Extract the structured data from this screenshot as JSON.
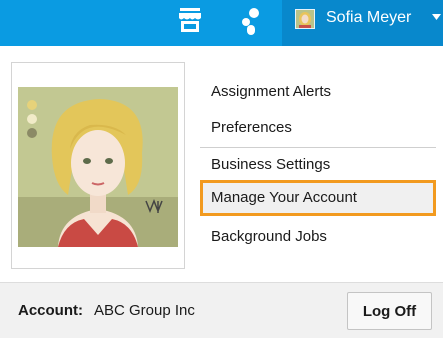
{
  "header": {
    "store_icon": "store-icon",
    "apps_icon": "apps-icon",
    "user_name": "Sofia Meyer",
    "dropdown_icon": "caret-down-icon",
    "bg_color": "#0a9be2"
  },
  "profile": {
    "photo": "profile-photo"
  },
  "menu": {
    "items": [
      {
        "label": "Assignment Alerts"
      },
      {
        "label": "Preferences"
      },
      {
        "label": "Business Settings"
      },
      {
        "label": "Manage Your Account",
        "highlighted": true
      },
      {
        "label": "Background Jobs"
      }
    ],
    "highlight_color": "#f29a1f"
  },
  "footer": {
    "account_label": "Account:",
    "account_value": "ABC Group Inc",
    "logoff_label": "Log Off"
  }
}
